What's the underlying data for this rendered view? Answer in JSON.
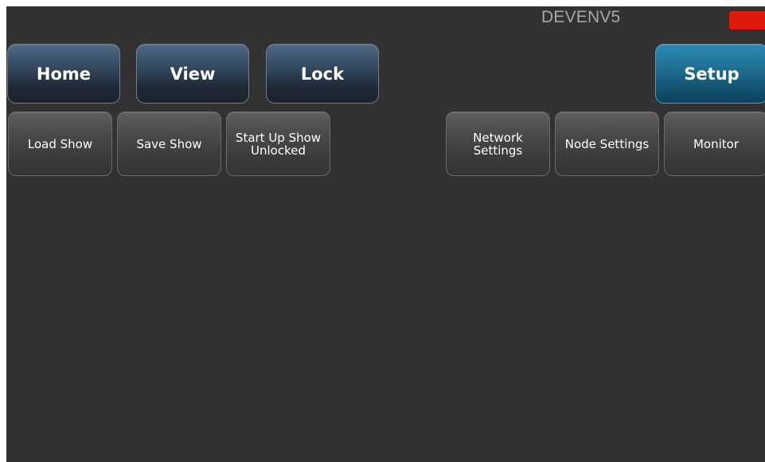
{
  "header": {
    "device_name": "DEVENV5",
    "status_color": "#e0190f"
  },
  "tabs": [
    {
      "label": "Home",
      "active": false
    },
    {
      "label": "View",
      "active": false
    },
    {
      "label": "Lock",
      "active": false
    },
    {
      "label": "Setup",
      "active": true
    }
  ],
  "setup_buttons": {
    "load_show": "Load Show",
    "save_show": "Save Show",
    "startup_show": "Start Up Show\nUnlocked",
    "network_settings": "Network\nSettings",
    "node_settings": "Node Settings",
    "monitor": "Monitor"
  },
  "colors": {
    "background": "#323232",
    "tab_accent": "#1f6e92"
  }
}
